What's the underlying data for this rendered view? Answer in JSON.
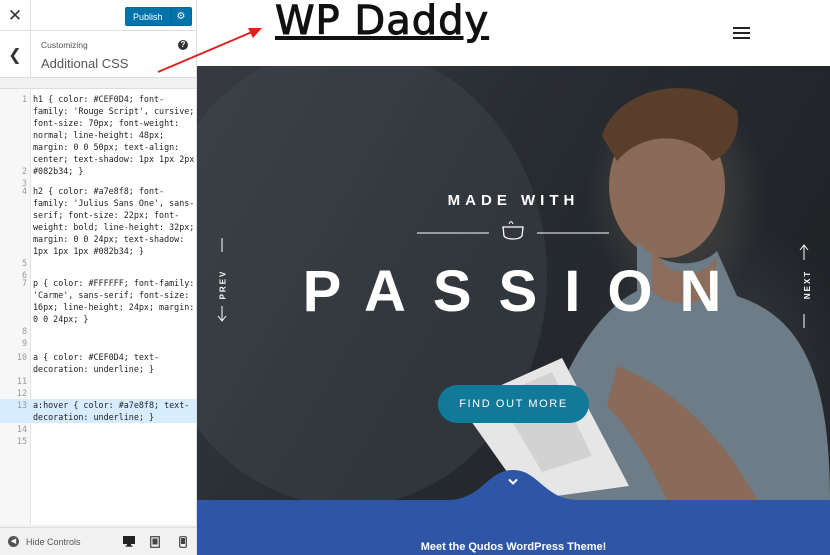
{
  "customizer": {
    "close_icon": "close-icon",
    "publish_label": "Publish",
    "settings_icon": "gear-icon",
    "back_icon": "chevron-left-icon",
    "customizing_label": "Customizing",
    "section_title": "Additional CSS",
    "help_icon": "help-icon",
    "hide_controls_label": "Hide Controls",
    "devices": [
      "desktop",
      "tablet",
      "mobile"
    ],
    "selected_device": "desktop"
  },
  "css_editor": {
    "active_line": 13,
    "lines": [
      {
        "num": "1",
        "text": "h1 { color: #CEF0D4; font-family: 'Rouge Script', cursive; font-size: 70px; font-weight: normal; line-height: 48px; margin: 0 0 50px; text-align: center; text-shadow: 1px 1px 2px #082b34; }"
      },
      {
        "num": "2",
        "text": ""
      },
      {
        "num": "3",
        "text": ""
      },
      {
        "num": "4",
        "text": "h2 { color: #a7e8f8; font-family: 'Julius Sans One', sans-serif; font-size: 22px; font-weight: bold; line-height: 32px; margin: 0 0 24px; text-shadow: 1px 1px 1px #082b34; }"
      },
      {
        "num": "5",
        "text": ""
      },
      {
        "num": "6",
        "text": ""
      },
      {
        "num": "7",
        "text": "p { color: #FFFFFF; font-family: 'Carme', sans-serif; font-size: 16px; line-height: 24px; margin: 0 0 24px; }"
      },
      {
        "num": "8",
        "text": ""
      },
      {
        "num": "9",
        "text": ""
      },
      {
        "num": "10",
        "text": "a { color: #CEF0D4; text-decoration: underline; }"
      },
      {
        "num": "11",
        "text": ""
      },
      {
        "num": "12",
        "text": ""
      },
      {
        "num": "13",
        "text": "a:hover { color: #a7e8f8; text-decoration: underline; }"
      },
      {
        "num": "14",
        "text": ""
      },
      {
        "num": "15",
        "text": ""
      }
    ]
  },
  "preview": {
    "logo_text": "WP Daddy",
    "menu_icon": "hamburger-menu-icon",
    "hero": {
      "subtitle": "MADE WITH",
      "title": "PASSION",
      "prev_label": "PREV",
      "next_label": "NEXT",
      "button_label": "FIND OUT MORE",
      "scroll_icon": "chevron-down-icon"
    },
    "band_text": "Meet the Qudos WordPress Theme!"
  },
  "colors": {
    "publish_blue": "#0073aa",
    "button_teal": "#117a9a",
    "band_blue": "#2f56a6",
    "active_line": "#d8ecff",
    "annotation_red": "#e02020"
  }
}
